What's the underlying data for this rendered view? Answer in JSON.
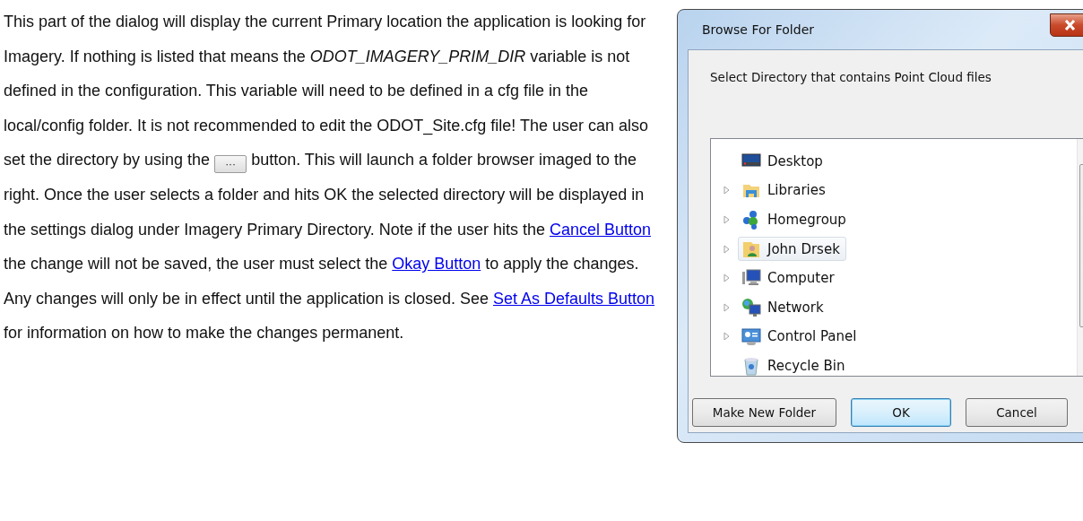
{
  "document": {
    "paragraph": [
      {
        "kind": "text",
        "text": "This part of the dialog will display the current Primary location the application is looking for Imagery. If nothing is listed that means the "
      },
      {
        "kind": "italic",
        "text": "ODOT_IMAGERY_PRIM_DIR"
      },
      {
        "kind": "text",
        "text": " variable is not defined in the configuration. This variable will need to be defined in a cfg file in the local/config folder.  It is not recommended to edit the ODOT_Site.cfg file! The user can also set the directory by using the "
      },
      {
        "kind": "button",
        "text": "···"
      },
      {
        "kind": "text",
        "text": " button. This will launch a folder browser imaged to the right. Once the user selects a folder and hits OK the selected directory will be displayed in the settings dialog under Imagery Primary Directory. Note if the user hits the "
      },
      {
        "kind": "link",
        "text": "Cancel Button"
      },
      {
        "kind": "text",
        "text": "  the change will not be saved, the user must select the "
      },
      {
        "kind": "link",
        "text": "Okay Button"
      },
      {
        "kind": "text",
        "text": " to apply the changes. Any changes will only be in effect until the application is closed. See "
      },
      {
        "kind": "link",
        "text": "Set As Defaults Button"
      },
      {
        "kind": "text",
        "text": " for information on how to make the changes permanent."
      }
    ]
  },
  "dialog": {
    "title": "Browse For Folder",
    "instruction": "Select Directory that contains Point Cloud files",
    "tree": [
      {
        "label": "Desktop",
        "expandable": false,
        "selected": false
      },
      {
        "label": "Libraries",
        "expandable": true,
        "selected": false
      },
      {
        "label": "Homegroup",
        "expandable": true,
        "selected": false
      },
      {
        "label": "John Drsek",
        "expandable": true,
        "selected": true
      },
      {
        "label": "Computer",
        "expandable": true,
        "selected": false
      },
      {
        "label": "Network",
        "expandable": true,
        "selected": false
      },
      {
        "label": "Control Panel",
        "expandable": true,
        "selected": false
      },
      {
        "label": "Recycle Bin",
        "expandable": false,
        "selected": false
      }
    ],
    "buttons": [
      {
        "label": "Make New Folder",
        "default": false
      },
      {
        "label": "OK",
        "default": true
      },
      {
        "label": "Cancel",
        "default": false
      }
    ]
  }
}
